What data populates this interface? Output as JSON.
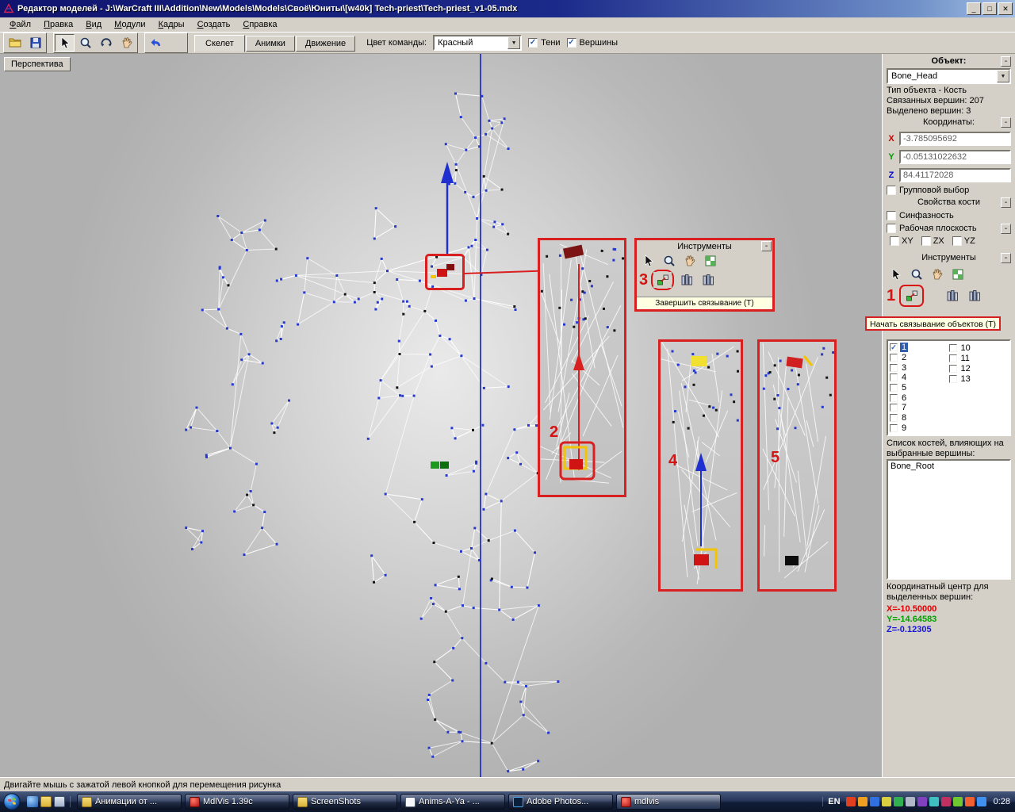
{
  "window": {
    "title": "Редактор моделей - J:\\WarCraft III\\Addition\\New\\Models\\Models\\Своё\\Юниты\\[w40k] Tech-priest\\Tech-priest_v1-05.mdx",
    "controls": {
      "minimize": "_",
      "maximize": "□",
      "close": "✕"
    }
  },
  "menu": {
    "items": [
      "Файл",
      "Правка",
      "Вид",
      "Модули",
      "Кадры",
      "Создать",
      "Справка"
    ]
  },
  "toolbar": {
    "tabs": {
      "skeleton": "Скелет",
      "anims": "Анимки",
      "movement": "Движение"
    },
    "team_color_label": "Цвет команды:",
    "team_color_value": "Красный",
    "shadows": "Тени",
    "vertices": "Вершины"
  },
  "viewport": {
    "view_label": "Перспектива"
  },
  "annotations": {
    "step1": "1",
    "step2": "2",
    "step3": "3",
    "step4": "4",
    "step5": "5",
    "inset_tools_title": "Инструменты",
    "tooltip_finish": "Завершить связывание (T)",
    "tooltip_start": "Начать связывание объектов (T)"
  },
  "panel": {
    "minus": "-",
    "object_header": "Объект:",
    "object_name": "Bone_Head",
    "object_type": "Тип объекта - Кость",
    "linked_vertices": "Связанных вершин: 207",
    "selected_vertices": "Выделено вершин: 3",
    "coords_header": "Координаты:",
    "coords": {
      "x_label": "X",
      "x_value": "-3.785095692",
      "y_label": "Y",
      "y_value": "-0.05131022632",
      "z_label": "Z",
      "z_value": "84.41172028"
    },
    "group_select": "Групповой выбор",
    "bone_props_header": "Свойства кости",
    "synphase": "Синфазность",
    "work_plane": "Рабочая плоскость",
    "planes": [
      "XY",
      "ZX",
      "YZ"
    ],
    "tools_header": "Инструменты",
    "surfaces": {
      "left": [
        "1",
        "2",
        "3",
        "4",
        "5",
        "6",
        "7",
        "8",
        "9"
      ],
      "right": [
        "10",
        "11",
        "12",
        "13"
      ]
    },
    "bones_list_label": "Список костей, влияющих на выбранные вершины:",
    "bones": [
      "Bone_Root"
    ],
    "coord_center_label": "Координатный центр для выделенных вершин:",
    "center": {
      "x": "X=-10.50000",
      "y": "Y=-14.64583",
      "z": "Z=-0.12305"
    }
  },
  "status_bar": {
    "text": "Двигайте мышь с зажатой левой кнопкой для перемещения  рисунка"
  },
  "taskbar": {
    "buttons": [
      "Анимации от ...",
      "MdlVis 1.39c",
      "ScreenShots",
      "Anims-A-Ya - ...",
      "Adobe Photos...",
      "mdlvis"
    ],
    "language": "EN",
    "clock": "0:28"
  },
  "colors": {
    "annotation_red": "#d82020",
    "axis_blue": "#2732c4",
    "selection_blue": "#2f5fae"
  }
}
